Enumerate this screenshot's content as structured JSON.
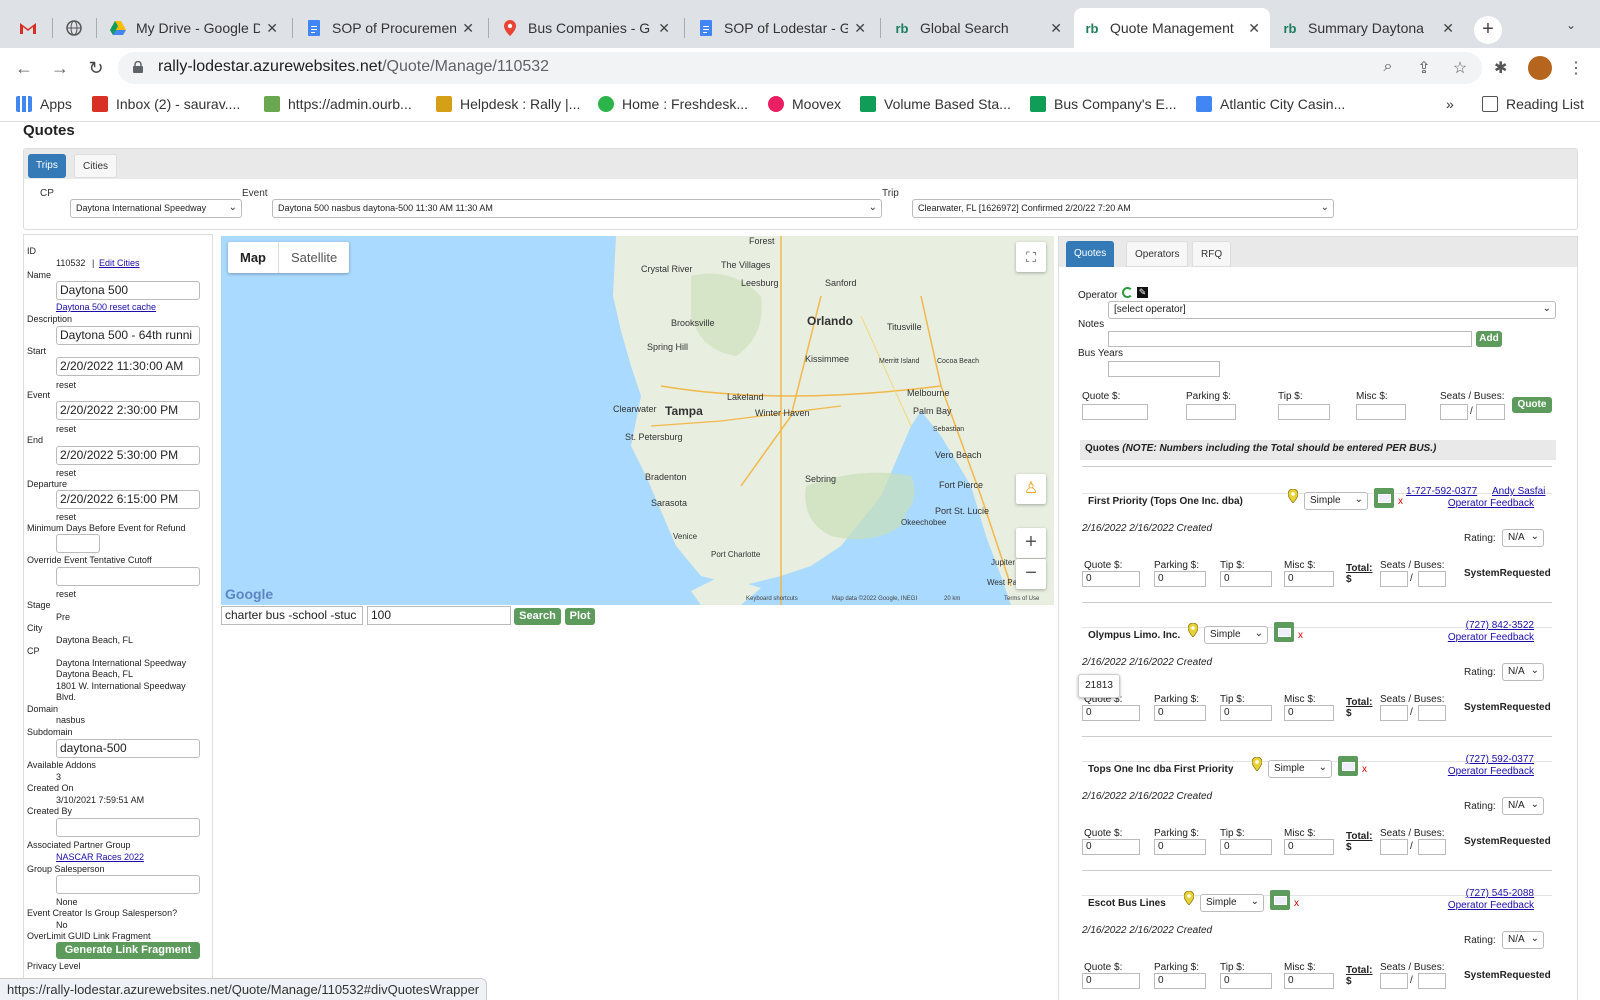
{
  "browser": {
    "tabs": [
      {
        "label": "",
        "icon": "gmail-icon"
      },
      {
        "label": "",
        "icon": "globe-icon"
      },
      {
        "label": "My Drive - Google D",
        "icon": "google-drive-icon"
      },
      {
        "label": "SOP of Procuremen",
        "icon": "google-docs-icon"
      },
      {
        "label": "Bus Companies - G",
        "icon": "google-maps-icon"
      },
      {
        "label": "SOP of Lodestar - G",
        "icon": "google-docs-icon"
      },
      {
        "label": "Global Search",
        "icon": "rb-icon"
      },
      {
        "label": "Quote Management",
        "icon": "rb-icon"
      },
      {
        "label": "Summary Daytona",
        "icon": "rb-icon"
      }
    ],
    "url_host": "rally-lodestar.azurewebsites.net",
    "url_path": "/Quote/Manage/110532",
    "bookmarks": [
      "Apps",
      "Inbox (2) - saurav....",
      "https://admin.ourb...",
      "Helpdesk : Rally |...",
      "Home : Freshdesk...",
      "Moovex",
      "Volume Based Sta...",
      "Bus Company's E...",
      "Atlantic City Casin..."
    ],
    "more": "»",
    "reading_list": "Reading List",
    "status_url": "https://rally-lodestar.azurewebsites.net/Quote/Manage/110532#divQuotesWrapper"
  },
  "page": {
    "title": "Quotes",
    "tabs": [
      "Trips",
      "Cities"
    ],
    "cp_label": "CP",
    "cp_value": "Daytona International Speedway",
    "event_label": "Event",
    "event_value": "Daytona 500 nasbus daytona-500 11:30 AM 11:30 AM",
    "trip_label": "Trip",
    "trip_value": "Clearwater, FL [1626972] Confirmed 2/20/22 7:20 AM"
  },
  "details": {
    "id_label": "ID",
    "id_value": "110532",
    "sep": "|",
    "edit_cities": "Edit Cities",
    "name_label": "Name",
    "name_value": "Daytona 500",
    "reset_cache": "Daytona 500 reset cache",
    "description_label": "Description",
    "description_value": "Daytona 500 - 64th runni",
    "start_label": "Start",
    "start_value": "2/20/2022 11:30:00 AM",
    "event_label": "Event",
    "event_value": "2/20/2022 2:30:00 PM",
    "end_label": "End",
    "end_value": "2/20/2022 5:30:00 PM",
    "departure_label": "Departure",
    "departure_value": "2/20/2022 6:15:00 PM",
    "reset": "reset",
    "min_days_label": "Minimum Days Before Event for Refund",
    "override_label": "Override Event Tentative Cutoff",
    "stage_label": "Stage",
    "stage_value": "Pre",
    "city_label": "City",
    "city_value": "Daytona Beach, FL",
    "cp_label": "CP",
    "cp_line1": "Daytona International Speedway",
    "cp_line2": "Daytona Beach, FL",
    "cp_line3": "1801 W. International Speedway",
    "cp_line4": "Blvd.",
    "domain_label": "Domain",
    "domain_value": "nasbus",
    "subdomain_label": "Subdomain",
    "subdomain_value": "daytona-500",
    "addons_label": "Available Addons",
    "addons_value": "3",
    "created_on_label": "Created On",
    "created_on_value": "3/10/2021 7:59:51 AM",
    "created_by_label": "Created By",
    "partner_label": "Associated Partner Group",
    "partner_value": "NASCAR Races 2022",
    "group_sales_label": "Group Salesperson",
    "group_sales_value": "None",
    "creator_label": "Event Creator Is Group Salesperson?",
    "creator_value": "No",
    "overlimit_label": "OverLimit GUID Link Fragment",
    "generate_button": "Generate Link Fragment",
    "privacy_label": "Privacy Level"
  },
  "map": {
    "map_btn": "Map",
    "satellite_btn": "Satellite",
    "labels": {
      "forest": "Forest",
      "crystal_river": "Crystal River",
      "villages": "The Villages",
      "leesburg": "Leesburg",
      "sanford": "Sanford",
      "brooksville": "Brooksville",
      "orlando": "Orlando",
      "titusville": "Titusville",
      "spring_hill": "Spring Hill",
      "kissimmee": "Kissimmee",
      "merritt": "Merritt Island",
      "cocoa": "Cocoa Beach",
      "lakeland": "Lakeland",
      "melbourne": "Melbourne",
      "clearwater": "Clearwater",
      "tampa": "Tampa",
      "winter_haven": "Winter Haven",
      "palm_bay": "Palm Bay",
      "st_pete": "St. Petersburg",
      "sebastian": "Sebastian",
      "vero": "Vero Beach",
      "bradenton": "Bradenton",
      "sebring": "Sebring",
      "fort_pierce": "Fort Pierce",
      "sarasota": "Sarasota",
      "port_st_lucie": "Port St. Lucie",
      "okeechobee": "Okeechobee",
      "venice": "Venice",
      "port_charlotte": "Port Charlotte",
      "jupiter": "Jupiter",
      "west_palm": "West Palm"
    },
    "google": "Google",
    "footer_keys": "Keyboard shortcuts",
    "footer_data": "Map data ©2022 Google, INEGI",
    "footer_scale": "20 km",
    "footer_terms": "Terms of Use",
    "search_value": "charter bus -school -stuc",
    "radius_value": "100",
    "search_btn": "Search",
    "plot_btn": "Plot"
  },
  "quotes": {
    "tabs": [
      "Quotes",
      "Operators",
      "RFQ"
    ],
    "operator_label": "Operator",
    "operator_placeholder": "[select operator]",
    "notes_label": "Notes",
    "add_btn": "Add",
    "bus_years_label": "Bus Years",
    "quote_label": "Quote $:",
    "parking_label": "Parking $:",
    "tip_label": "Tip $:",
    "misc_label": "Misc $:",
    "seats_label": "Seats / Buses:",
    "slash": "/",
    "quote_btn": "Quote",
    "note_prefix": "Quotes ",
    "note_text": "(NOTE: Numbers including the Total should be entered PER BUS.)",
    "total_label": "Total:",
    "dollar": "$",
    "rating_label": "Rating:",
    "rating_value": "N/A",
    "tooltip": "21813",
    "items": [
      {
        "name": "First Priority (Tops One Inc. dba)",
        "type": "Simple",
        "phone": "1-727-592-0377",
        "contact": "Andy Sasfai",
        "feedback": "Operator Feedback",
        "created": "2/16/2022 2/16/2022 Created",
        "quote": "0",
        "parking": "0",
        "tip": "0",
        "misc": "0",
        "status": "SystemRequested"
      },
      {
        "name": "Olympus Limo. Inc.",
        "type": "Simple",
        "phone": "(727) 842-3522",
        "contact": "",
        "feedback": "Operator Feedback",
        "created": "2/16/2022 2/16/2022 Created",
        "quote": "0",
        "parking": "0",
        "tip": "0",
        "misc": "0",
        "status": "SystemRequested"
      },
      {
        "name": "Tops One Inc dba First Priority",
        "type": "Simple",
        "phone": "(727) 592-0377",
        "contact": "",
        "feedback": "Operator Feedback",
        "created": "2/16/2022 2/16/2022 Created",
        "quote": "0",
        "parking": "0",
        "tip": "0",
        "misc": "0",
        "status": "SystemRequested"
      },
      {
        "name": "Escot Bus Lines",
        "type": "Simple",
        "phone": "(727) 545-2088",
        "contact": "",
        "feedback": "Operator Feedback",
        "created": "2/16/2022 2/16/2022 Created",
        "quote": "0",
        "parking": "0",
        "tip": "0",
        "misc": "0",
        "status": "SystemRequested"
      }
    ]
  },
  "colors": {
    "accent_blue": "#337ab7",
    "button_green": "#5c9b5c",
    "link_blue": "#1a0dab",
    "map_water": "#aadaff",
    "map_land": "#e8eee0"
  }
}
